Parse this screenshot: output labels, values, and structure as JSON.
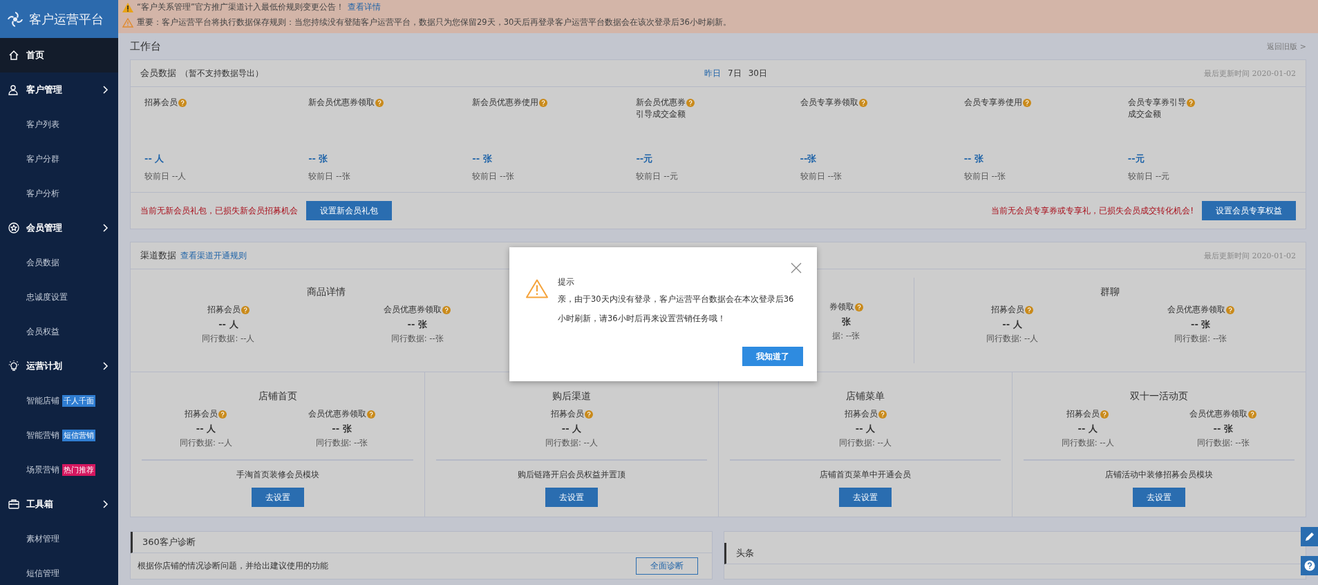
{
  "sidebar": {
    "logo": "客户运营平台",
    "items": [
      {
        "label": "首页",
        "selected": true
      },
      {
        "label": "客户管理",
        "selected": false,
        "children": [
          {
            "label": "客户列表",
            "selected": false
          },
          {
            "label": "客户分群",
            "selected": false
          },
          {
            "label": "客户分析",
            "selected": false
          }
        ]
      },
      {
        "label": "会员管理",
        "selected": false,
        "children": [
          {
            "label": "会员数据",
            "selected": false
          },
          {
            "label": "忠诚度设置",
            "selected": false
          },
          {
            "label": "会员权益",
            "selected": false
          }
        ]
      },
      {
        "label": "运营计划",
        "selected": false,
        "children": [
          {
            "label": "智能店铺",
            "selected": false,
            "tag": "千人千面",
            "color": "#2f7dd1"
          },
          {
            "label": "智能营销",
            "selected": false,
            "tag": "短信营销",
            "color": "#2f7dd1"
          },
          {
            "label": "场景营销",
            "selected": false,
            "tag": "热门推荐",
            "color": "#d5175f"
          }
        ]
      },
      {
        "label": "工具箱",
        "selected": false,
        "children": [
          {
            "label": "素材管理",
            "selected": false
          },
          {
            "label": "短信管理",
            "selected": false
          }
        ]
      }
    ]
  },
  "banners": [
    {
      "kind": "notice",
      "text": "“客户关系管理”官方推广渠道计入最低价规则变更公告！",
      "link": "查看详情"
    },
    {
      "kind": "important",
      "text": "重要：客户运营平台将执行数据保存规则：当您持续没有登陆客户运营平台，数据只为您保留29天，30天后再登录客户运营平台数据会在该次登录后36小时刷新。"
    }
  ],
  "page_title": "工作台",
  "back_link": "返回旧版 >",
  "member_data": {
    "title": "会员数据",
    "note": "（暂不支持数据导出）",
    "ranges": [
      {
        "label": "昨日",
        "selected": true
      },
      {
        "label": "7日",
        "selected": false
      },
      {
        "label": "30日",
        "selected": false
      }
    ],
    "updated": "最后更新时间 2020-01-02",
    "metrics": [
      {
        "label": "招募会员",
        "value": "-- 人",
        "compare": "较前日 --人"
      },
      {
        "label": "新会员优惠券领取",
        "value": "-- 张",
        "compare": "较前日 --张"
      },
      {
        "label": "新会员优惠券使用",
        "value": "-- 张",
        "compare": "较前日 --张"
      },
      {
        "label": "新会员优惠券",
        "label_2": "引导成交金额",
        "value": "--元",
        "compare": "较前日 --元"
      },
      {
        "label": "会员专享券领取",
        "value": "--张",
        "compare": "较前日 --张"
      },
      {
        "label": "会员专享券使用",
        "value": "-- 张",
        "compare": "较前日 --张"
      },
      {
        "label": "会员专享券引导",
        "label_2": "成交金额",
        "value": "--元",
        "compare": "较前日 --元"
      }
    ],
    "alerts": [
      {
        "text": "当前无新会员礼包，已损失新会员招募机会",
        "button": "设置新会员礼包"
      },
      {
        "text": "当前无会员专享券或专享礼，已损失会员成交转化机会!",
        "button": "设置会员专享权益"
      }
    ]
  },
  "channel_data": {
    "title": "渠道数据",
    "link": "查看渠道开通规则",
    "updated": "最后更新时间 2020-01-02",
    "top_sections": [
      {
        "title": "商品详情",
        "metrics": [
          {
            "label": "招募会员",
            "value": "-- 人",
            "peer": "同行数据: --人"
          },
          {
            "label": "会员优惠券领取",
            "value": "-- 张",
            "peer": "同行数据: --张"
          }
        ]
      },
      {
        "metrics": [
          {
            "label": "券领取",
            "value": "张",
            "peer": "据: --张"
          }
        ]
      },
      {
        "title": "群聊",
        "metrics": [
          {
            "label": "招募会员",
            "value": "-- 人",
            "peer": "同行数据: --人"
          },
          {
            "label": "会员优惠券领取",
            "value": "-- 张",
            "peer": "同行数据: --张"
          }
        ]
      }
    ],
    "bottom_sections": [
      {
        "title": "店铺首页",
        "metrics": [
          {
            "label": "招募会员",
            "value": "-- 人",
            "peer": "同行数据: --人"
          },
          {
            "label": "会员优惠券领取",
            "value": "-- 张",
            "peer": "同行数据: --张"
          }
        ],
        "action": "手淘首页装修会员模块",
        "button": "去设置"
      },
      {
        "title": "购后渠道",
        "metrics": [
          {
            "label": "招募会员",
            "value": "-- 人",
            "peer": "同行数据: --人"
          }
        ],
        "action": "购后链路开启会员权益并置顶",
        "button": "去设置"
      },
      {
        "title": "店铺菜单",
        "metrics": [
          {
            "label": "招募会员",
            "value": "-- 人",
            "peer": "同行数据: --人"
          }
        ],
        "action": "店铺首页菜单中开通会员",
        "button": "去设置"
      },
      {
        "title": "双十一活动页",
        "metrics": [
          {
            "label": "招募会员",
            "value": "-- 人",
            "peer": "同行数据: --人"
          },
          {
            "label": "会员优惠券领取",
            "value": "-- 张",
            "peer": "同行数据: --张"
          }
        ],
        "action": "店铺活动中装修招募会员模块",
        "button": "去设置"
      }
    ]
  },
  "diagnosis": {
    "title": "360客户诊断",
    "text": "根据你店铺的情况诊断问题，并给出建议使用的功能",
    "button": "全面诊断"
  },
  "news": {
    "title": "头条"
  },
  "dialog": {
    "title": "提示",
    "message": "亲，由于30天内没有登录，客户运营平台数据会在本次登录后36小时刷新，请36小时后再来设置营销任务哦！",
    "button": "我知道了"
  }
}
